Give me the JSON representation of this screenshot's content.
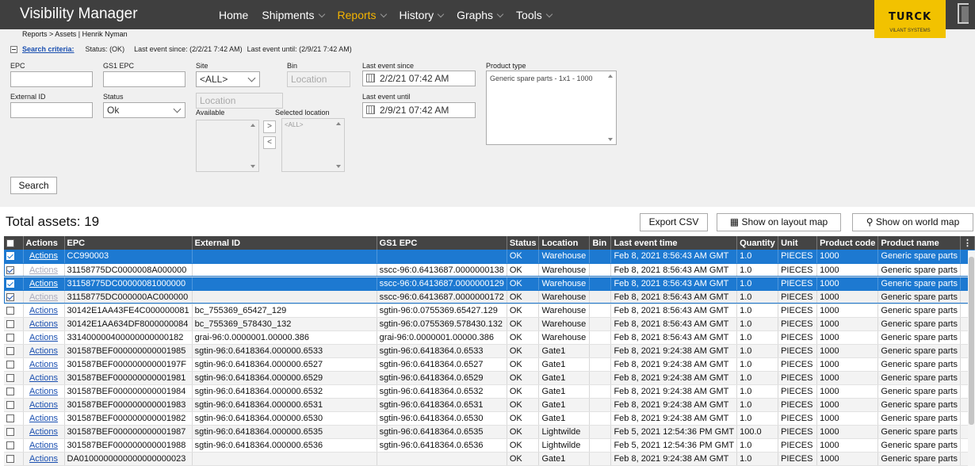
{
  "header": {
    "app_title": "Visibility Manager",
    "nav": [
      {
        "label": "Home",
        "dropdown": false,
        "active": false
      },
      {
        "label": "Shipments",
        "dropdown": true,
        "active": false
      },
      {
        "label": "Reports",
        "dropdown": true,
        "active": true
      },
      {
        "label": "History",
        "dropdown": true,
        "active": false
      },
      {
        "label": "Graphs",
        "dropdown": true,
        "active": false
      },
      {
        "label": "Tools",
        "dropdown": true,
        "active": false
      }
    ],
    "logo_text": "TURCK",
    "logo_subtext": "VILANT SYSTEMS",
    "accent_color": "#f5b400"
  },
  "breadcrumb": "Reports > Assets | Henrik Nyman",
  "criteria": {
    "link": "Search criteria:",
    "status": "Status: (OK)",
    "since": "Last event since: (2/2/21 7:42 AM)",
    "until": "Last event until: (2/9/21 7:42 AM)"
  },
  "form": {
    "epc_label": "EPC",
    "epc_value": "",
    "gs1_label": "GS1 EPC",
    "gs1_value": "",
    "site_label": "Site",
    "site_value": "<ALL>",
    "bin_label": "Bin",
    "bin_placeholder": "Location",
    "location_placeholder": "Location",
    "external_label": "External ID",
    "external_value": "",
    "status_label": "Status",
    "status_value": "Ok",
    "available_label": "Available",
    "selected_label": "Selected location",
    "selected_placeholder": "<ALL>",
    "move_right": ">",
    "move_left": "<",
    "since_label": "Last event since",
    "since_value": "2/2/21 07:42 AM",
    "until_label": "Last event until",
    "until_value": "2/9/21 07:42 AM",
    "product_label": "Product type",
    "product_value": "Generic spare parts - 1x1 - 1000",
    "search_button": "Search"
  },
  "results": {
    "total": "Total assets: 19",
    "export_button": "Export CSV",
    "layout_button": "Show on layout map",
    "world_button": "Show on world map",
    "columns": [
      "Actions",
      "EPC",
      "External ID",
      "GS1 EPC",
      "Status",
      "Location",
      "Bin",
      "Last event time",
      "Quantity",
      "Unit",
      "Product code",
      "Product name"
    ],
    "menu_glyph": "⋮",
    "rows": [
      {
        "checked": true,
        "style": "sel",
        "actions_faded": false,
        "cells": [
          "Actions",
          "CC990003",
          "",
          "",
          "OK",
          "Warehouse",
          "",
          "Feb 8, 2021 8:56:43 AM GMT",
          "1.0",
          "PIECES",
          "1000",
          "Generic spare parts"
        ]
      },
      {
        "checked": true,
        "style": "chk",
        "actions_faded": true,
        "cells": [
          "Actions",
          "31158775DC0000008A000000",
          "",
          "sscc-96:0.6413687.0000000138",
          "OK",
          "Warehouse",
          "",
          "Feb 8, 2021 8:56:43 AM GMT",
          "1.0",
          "PIECES",
          "1000",
          "Generic spare parts"
        ]
      },
      {
        "checked": true,
        "style": "sel",
        "actions_faded": false,
        "cells": [
          "Actions",
          "31158775DC00000081000000",
          "",
          "sscc-96:0.6413687.0000000129",
          "OK",
          "Warehouse",
          "",
          "Feb 8, 2021 8:56:43 AM GMT",
          "1.0",
          "PIECES",
          "1000",
          "Generic spare parts"
        ]
      },
      {
        "checked": true,
        "style": "chk-grey",
        "actions_faded": true,
        "cells": [
          "Actions",
          "31158775DC000000AC000000",
          "",
          "sscc-96:0.6413687.0000000172",
          "OK",
          "Warehouse",
          "",
          "Feb 8, 2021 8:56:43 AM GMT",
          "1.0",
          "PIECES",
          "1000",
          "Generic spare parts"
        ]
      },
      {
        "checked": false,
        "style": "",
        "actions_faded": false,
        "cells": [
          "Actions",
          "30142E1AA43FE4C000000081",
          "bc_755369_65427_129",
          "sgtin-96:0.0755369.65427.129",
          "OK",
          "Warehouse",
          "",
          "Feb 8, 2021 8:56:43 AM GMT",
          "1.0",
          "PIECES",
          "1000",
          "Generic spare parts"
        ]
      },
      {
        "checked": false,
        "style": "",
        "actions_faded": false,
        "cells": [
          "Actions",
          "30142E1AA634DF8000000084",
          "bc_755369_578430_132",
          "sgtin-96:0.0755369.578430.132",
          "OK",
          "Warehouse",
          "",
          "Feb 8, 2021 8:56:43 AM GMT",
          "1.0",
          "PIECES",
          "1000",
          "Generic spare parts"
        ]
      },
      {
        "checked": false,
        "style": "",
        "actions_faded": false,
        "cells": [
          "Actions",
          "331400000400000000000182",
          "grai-96:0.0000001.00000.386",
          "grai-96:0.0000001.00000.386",
          "OK",
          "Warehouse",
          "",
          "Feb 8, 2021 8:56:43 AM GMT",
          "1.0",
          "PIECES",
          "1000",
          "Generic spare parts"
        ]
      },
      {
        "checked": false,
        "style": "",
        "actions_faded": false,
        "cells": [
          "Actions",
          "301587BEF000000000001985",
          "sgtin-96:0.6418364.000000.6533",
          "sgtin-96:0.6418364.0.6533",
          "OK",
          "Gate1",
          "",
          "Feb 8, 2021 9:24:38 AM GMT",
          "1.0",
          "PIECES",
          "1000",
          "Generic spare parts"
        ]
      },
      {
        "checked": false,
        "style": "",
        "actions_faded": false,
        "cells": [
          "Actions",
          "301587BEF00000000000197F",
          "sgtin-96:0.6418364.000000.6527",
          "sgtin-96:0.6418364.0.6527",
          "OK",
          "Gate1",
          "",
          "Feb 8, 2021 9:24:38 AM GMT",
          "1.0",
          "PIECES",
          "1000",
          "Generic spare parts"
        ]
      },
      {
        "checked": false,
        "style": "",
        "actions_faded": false,
        "cells": [
          "Actions",
          "301587BEF000000000001981",
          "sgtin-96:0.6418364.000000.6529",
          "sgtin-96:0.6418364.0.6529",
          "OK",
          "Gate1",
          "",
          "Feb 8, 2021 9:24:38 AM GMT",
          "1.0",
          "PIECES",
          "1000",
          "Generic spare parts"
        ]
      },
      {
        "checked": false,
        "style": "",
        "actions_faded": false,
        "cells": [
          "Actions",
          "301587BEF000000000001984",
          "sgtin-96:0.6418364.000000.6532",
          "sgtin-96:0.6418364.0.6532",
          "OK",
          "Gate1",
          "",
          "Feb 8, 2021 9:24:38 AM GMT",
          "1.0",
          "PIECES",
          "1000",
          "Generic spare parts"
        ]
      },
      {
        "checked": false,
        "style": "",
        "actions_faded": false,
        "cells": [
          "Actions",
          "301587BEF000000000001983",
          "sgtin-96:0.6418364.000000.6531",
          "sgtin-96:0.6418364.0.6531",
          "OK",
          "Gate1",
          "",
          "Feb 8, 2021 9:24:38 AM GMT",
          "1.0",
          "PIECES",
          "1000",
          "Generic spare parts"
        ]
      },
      {
        "checked": false,
        "style": "",
        "actions_faded": false,
        "cells": [
          "Actions",
          "301587BEF000000000001982",
          "sgtin-96:0.6418364.000000.6530",
          "sgtin-96:0.6418364.0.6530",
          "OK",
          "Gate1",
          "",
          "Feb 8, 2021 9:24:38 AM GMT",
          "1.0",
          "PIECES",
          "1000",
          "Generic spare parts"
        ]
      },
      {
        "checked": false,
        "style": "",
        "actions_faded": false,
        "cells": [
          "Actions",
          "301587BEF000000000001987",
          "sgtin-96:0.6418364.000000.6535",
          "sgtin-96:0.6418364.0.6535",
          "OK",
          "Lightwilde",
          "",
          "Feb 5, 2021 12:54:36 PM GMT",
          "100.0",
          "PIECES",
          "1000",
          "Generic spare parts"
        ]
      },
      {
        "checked": false,
        "style": "",
        "actions_faded": false,
        "cells": [
          "Actions",
          "301587BEF000000000001988",
          "sgtin-96:0.6418364.000000.6536",
          "sgtin-96:0.6418364.0.6536",
          "OK",
          "Lightwilde",
          "",
          "Feb 5, 2021 12:54:36 PM GMT",
          "1.0",
          "PIECES",
          "1000",
          "Generic spare parts"
        ]
      },
      {
        "checked": false,
        "style": "",
        "actions_faded": false,
        "cells": [
          "Actions",
          "DA0100000000000000000023",
          "",
          "",
          "OK",
          "Gate1",
          "",
          "Feb 8, 2021 9:24:38 AM GMT",
          "1.0",
          "PIECES",
          "1000",
          "Generic spare parts"
        ]
      }
    ]
  }
}
